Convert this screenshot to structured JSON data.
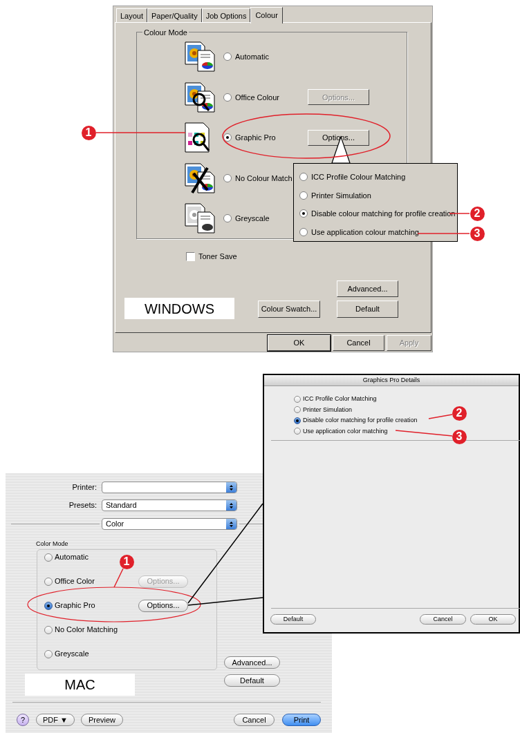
{
  "windows_dialog": {
    "tabs": [
      {
        "label": "Layout",
        "selected": false
      },
      {
        "label": "Paper/Quality",
        "selected": false
      },
      {
        "label": "Job Options",
        "selected": false
      },
      {
        "label": "Colour",
        "selected": true
      }
    ],
    "colour_mode": {
      "title": "Colour Mode",
      "modes": [
        {
          "label": "Automatic",
          "selected": false
        },
        {
          "label": "Office Colour",
          "selected": false,
          "options_button": {
            "label": "Options...",
            "disabled": true
          }
        },
        {
          "label": "Graphic Pro",
          "selected": true,
          "options_button": {
            "label": "Options...",
            "disabled": false
          }
        },
        {
          "label": "No Colour Match",
          "selected": false
        },
        {
          "label": "Greyscale",
          "selected": false
        }
      ]
    },
    "options_popup": {
      "options": [
        {
          "label": "ICC Profile Colour Matching",
          "selected": false
        },
        {
          "label": "Printer Simulation",
          "selected": false
        },
        {
          "label": "Disable colour matching for profile creation",
          "selected": true
        },
        {
          "label": "Use application colour matching",
          "selected": false
        }
      ]
    },
    "toner_save": {
      "label": "Toner Save",
      "checked": false
    },
    "caption": "WINDOWS",
    "advanced_button": "Advanced...",
    "colour_swatch_button": "Colour Swatch...",
    "default_button": "Default",
    "footer_buttons": [
      {
        "label": "OK",
        "disabled": false,
        "default": true
      },
      {
        "label": "Cancel",
        "disabled": false,
        "default": false
      },
      {
        "label": "Apply",
        "disabled": true,
        "default": false
      }
    ]
  },
  "windows_callouts": [
    "1",
    "2",
    "3"
  ],
  "mac_dialog": {
    "fields": [
      {
        "label": "Printer:"
      },
      {
        "label": "Presets:",
        "value": "Standard"
      }
    ],
    "panel_menu": "Color",
    "color_mode": {
      "title": "Color Mode",
      "modes": [
        {
          "label": "Automatic",
          "selected": false
        },
        {
          "label": "Office Color",
          "selected": false,
          "options_button": {
            "label": "Options...",
            "disabled": true
          }
        },
        {
          "label": "Graphic Pro",
          "selected": true,
          "options_button": {
            "label": "Options...",
            "disabled": false
          }
        },
        {
          "label": "No Color Matching",
          "selected": false
        },
        {
          "label": "Greyscale",
          "selected": false
        }
      ]
    },
    "advanced_button": "Advanced...",
    "default_button": "Default",
    "caption": "MAC",
    "footer_buttons": [
      {
        "label": "?",
        "kind": "help"
      },
      {
        "label": "PDF ▼",
        "kind": "button",
        "default": false
      },
      {
        "label": "Preview",
        "kind": "button",
        "default": false
      },
      {
        "label": "Cancel",
        "kind": "button",
        "default": false
      },
      {
        "label": "Print",
        "kind": "button",
        "default": true
      }
    ]
  },
  "graphics_pro_details": {
    "title": "Graphics Pro Details",
    "options": [
      {
        "label": "ICC Profile Color Matching",
        "selected": false
      },
      {
        "label": "Printer Simulation",
        "selected": false
      },
      {
        "label": "Disable color matching for profile creation",
        "selected": true
      },
      {
        "label": "Use application color matching",
        "selected": false
      }
    ],
    "buttons": [
      "Default",
      "Cancel",
      "OK"
    ]
  },
  "mac_callouts": [
    "1",
    "2",
    "3"
  ]
}
